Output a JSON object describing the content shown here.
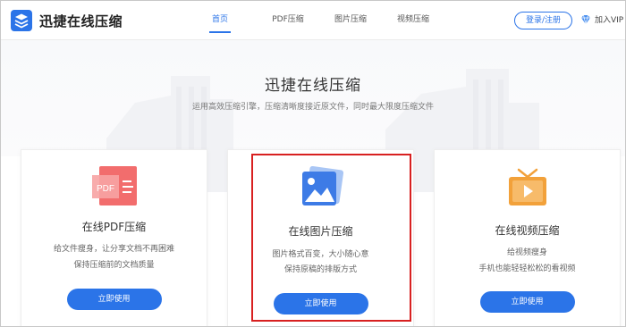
{
  "header": {
    "logo_text": "迅捷在线压缩",
    "nav": [
      "首页",
      "PDF压缩",
      "图片压缩",
      "视频压缩"
    ],
    "active_nav": "首页",
    "login_label": "登录/注册",
    "vip_label": "加入VIP"
  },
  "hero": {
    "title": "迅捷在线压缩",
    "subtitle": "运用高效压缩引擎，压缩清晰度接近原文件，同时最大限度压缩文件"
  },
  "cards": [
    {
      "title": "在线PDF压缩",
      "icon": "pdf-icon",
      "icon_text": "PDF",
      "desc_1": "给文件瘦身，让分享文档不再困难",
      "desc_2": "保持压缩前的文档质量",
      "button": "立即使用"
    },
    {
      "title": "在线图片压缩",
      "icon": "image-icon",
      "desc_1": "图片格式百变，大小随心意",
      "desc_2": "保持原稿的排版方式",
      "button": "立即使用"
    },
    {
      "title": "在线视频压缩",
      "icon": "video-tv-icon",
      "desc_1": "给视频瘦身",
      "desc_2": "手机也能轻轻松松的看视频",
      "button": "立即使用"
    }
  ],
  "colors": {
    "accent": "#2b74e8",
    "pdf": "#f26d6d",
    "image": "#3d7be6",
    "video": "#f2a13a",
    "highlight": "#d82020"
  }
}
